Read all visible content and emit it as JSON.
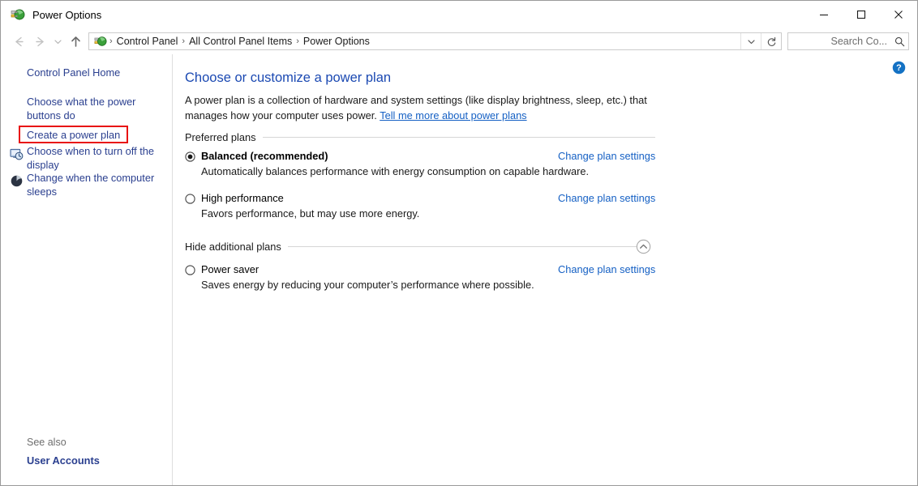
{
  "window": {
    "title": "Power Options",
    "app_icon": "power-plug-icon",
    "controls": {
      "minimize": "minimize-icon",
      "maximize": "maximize-icon",
      "close": "close-icon"
    }
  },
  "navbar": {
    "back": "back-arrow-icon",
    "forward": "forward-arrow-icon",
    "recent": "chevron-down-icon",
    "up": "up-arrow-icon",
    "breadcrumb": [
      "Control Panel",
      "All Control Panel Items",
      "Power Options"
    ],
    "separator": "›",
    "dropdown": "chevron-down-icon",
    "refresh": "refresh-icon",
    "search": {
      "value": "Search Co...",
      "placeholder": "Search Control Panel",
      "icon": "search-icon"
    }
  },
  "sidebar": {
    "items": [
      {
        "label": "Control Panel Home",
        "icon": null
      },
      {
        "label": "Choose what the power buttons do",
        "icon": null
      },
      {
        "label": "Create a power plan",
        "icon": null,
        "highlighted": true
      },
      {
        "label": "Choose when to turn off the display",
        "icon": "display-clock-icon"
      },
      {
        "label": "Change when the computer sleeps",
        "icon": "sleep-moon-icon"
      }
    ],
    "see_also": {
      "label": "See also",
      "links": [
        "User Accounts"
      ]
    }
  },
  "main": {
    "help_icon": "help-question-icon",
    "title": "Choose or customize a power plan",
    "intro_before": "A power plan is a collection of hardware and system settings (like display brightness, sleep, etc.) that manages how your computer uses power. ",
    "intro_link": "Tell me more about power plans",
    "groups": [
      {
        "name": "preferred-plans",
        "label": "Preferred plans",
        "collapse_icon": null,
        "plans": [
          {
            "name": "Balanced (recommended)",
            "selected": true,
            "bold": true,
            "description": "Automatically balances performance with energy consumption on capable hardware.",
            "link": "Change plan settings"
          },
          {
            "name": "High performance",
            "selected": false,
            "bold": false,
            "description": "Favors performance, but may use more energy.",
            "link": "Change plan settings"
          }
        ]
      },
      {
        "name": "additional-plans",
        "label": "Hide additional plans",
        "collapse_icon": "chevron-up-circle-icon",
        "plans": [
          {
            "name": "Power saver",
            "selected": false,
            "bold": false,
            "description": "Saves energy by reducing your computer’s performance where possible.",
            "link": "Change plan settings"
          }
        ]
      }
    ]
  },
  "colors": {
    "heading_blue": "#1b49b2",
    "link_blue": "#1560c4",
    "sidebar_link": "#2a3f8f",
    "highlight_red": "#e81313",
    "help_blue": "#1472c4"
  }
}
